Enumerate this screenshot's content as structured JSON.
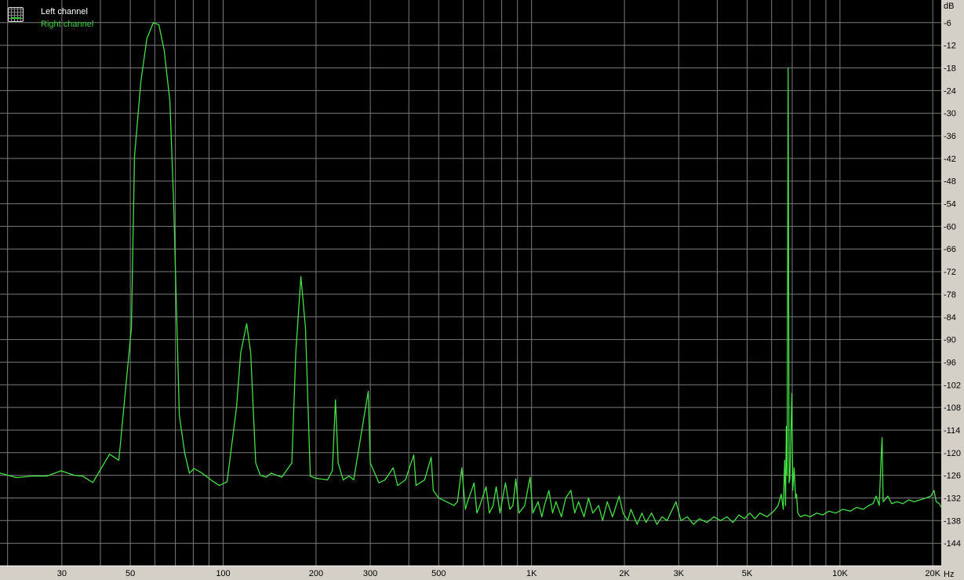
{
  "colors": {
    "background": "#000000",
    "grid": "#7a7a7a",
    "panel": "#d4d0c8",
    "right_channel": "#44e044",
    "left_channel": "#ffffff"
  },
  "legend": {
    "icon": "spectrum-graph-icon",
    "left_label": "Left channel",
    "right_label": "Right channel"
  },
  "chart_data": {
    "type": "line",
    "title": "",
    "xlabel": "Hz",
    "ylabel": "dB",
    "xscale": "log",
    "xlim": [
      18.9,
      21300
    ],
    "ylim": [
      -150,
      0
    ],
    "grid": true,
    "legend_position": "top-left",
    "x_ticks": [
      {
        "value": 30,
        "label": "30"
      },
      {
        "value": 50,
        "label": "50"
      },
      {
        "value": 100,
        "label": "100"
      },
      {
        "value": 200,
        "label": "200"
      },
      {
        "value": 300,
        "label": "300"
      },
      {
        "value": 500,
        "label": "500"
      },
      {
        "value": 1000,
        "label": "1K"
      },
      {
        "value": 2000,
        "label": "2K"
      },
      {
        "value": 3000,
        "label": "3K"
      },
      {
        "value": 5000,
        "label": "5K"
      },
      {
        "value": 10000,
        "label": "10K"
      },
      {
        "value": 20000,
        "label": "20K"
      }
    ],
    "x_grid": [
      20,
      30,
      40,
      50,
      60,
      70,
      80,
      90,
      100,
      200,
      300,
      400,
      500,
      600,
      700,
      800,
      900,
      1000,
      2000,
      3000,
      4000,
      5000,
      6000,
      7000,
      8000,
      9000,
      10000,
      20000
    ],
    "y_ticks": [
      "-6",
      "-12",
      "-18",
      "-24",
      "-30",
      "-36",
      "-42",
      "-48",
      "-54",
      "-60",
      "-66",
      "-72",
      "-78",
      "-84",
      "-90",
      "-96",
      "-102",
      "-108",
      "-114",
      "-120",
      "-126",
      "-132",
      "-138",
      "-144"
    ],
    "series": [
      {
        "name": "Right channel",
        "points": [
          [
            18.9,
            -125.4
          ],
          [
            21.4,
            -126.6
          ],
          [
            24,
            -126.2
          ],
          [
            26.8,
            -126.2
          ],
          [
            29.8,
            -124.8
          ],
          [
            32.9,
            -126
          ],
          [
            35,
            -126.2
          ],
          [
            37.8,
            -127.9
          ],
          [
            42.8,
            -120.4
          ],
          [
            45.9,
            -122
          ],
          [
            50.4,
            -87
          ],
          [
            51.6,
            -41.4
          ],
          [
            54.1,
            -21.6
          ],
          [
            56.6,
            -10.2
          ],
          [
            59.4,
            -6
          ],
          [
            61.9,
            -6.6
          ],
          [
            64.4,
            -13.3
          ],
          [
            67.2,
            -26.8
          ],
          [
            69.1,
            -53.9
          ],
          [
            72.1,
            -110
          ],
          [
            75,
            -120
          ],
          [
            77.7,
            -125.4
          ],
          [
            80.5,
            -124.2
          ],
          [
            85.4,
            -125.4
          ],
          [
            91.6,
            -127.3
          ],
          [
            97.1,
            -128.7
          ],
          [
            103,
            -127.7
          ],
          [
            110.5,
            -108
          ],
          [
            114,
            -93.5
          ],
          [
            119.2,
            -85.8
          ],
          [
            122.8,
            -93.5
          ],
          [
            127.5,
            -122.7
          ],
          [
            132,
            -126
          ],
          [
            138,
            -126.5
          ],
          [
            143,
            -125.4
          ],
          [
            155,
            -126.5
          ],
          [
            167,
            -122.7
          ],
          [
            172,
            -93.5
          ],
          [
            178.7,
            -73.3
          ],
          [
            185,
            -87
          ],
          [
            191.7,
            -126.2
          ],
          [
            200,
            -126.8
          ],
          [
            218,
            -127.2
          ],
          [
            226,
            -124.8
          ],
          [
            231.3,
            -106
          ],
          [
            236,
            -122.7
          ],
          [
            245,
            -127.2
          ],
          [
            256,
            -126.2
          ],
          [
            265,
            -127.2
          ],
          [
            295.5,
            -103.7
          ],
          [
            300,
            -122.7
          ],
          [
            320,
            -128
          ],
          [
            335,
            -127.2
          ],
          [
            356,
            -124
          ],
          [
            368,
            -128.7
          ],
          [
            390,
            -127.2
          ],
          [
            415,
            -120.6
          ],
          [
            422,
            -128.7
          ],
          [
            450,
            -127.2
          ],
          [
            472.5,
            -121.2
          ],
          [
            480,
            -130
          ],
          [
            500,
            -132
          ],
          [
            530,
            -133
          ],
          [
            560,
            -134
          ],
          [
            575,
            -133
          ],
          [
            594,
            -124
          ],
          [
            610,
            -135
          ],
          [
            620,
            -133
          ],
          [
            651,
            -128
          ],
          [
            665,
            -136
          ],
          [
            680,
            -134
          ],
          [
            712,
            -129
          ],
          [
            730,
            -136
          ],
          [
            750,
            -134
          ],
          [
            768,
            -129
          ],
          [
            790,
            -136
          ],
          [
            823,
            -128
          ],
          [
            850,
            -135
          ],
          [
            870,
            -134
          ],
          [
            889,
            -127
          ],
          [
            910,
            -136
          ],
          [
            950,
            -134
          ],
          [
            989,
            -126.5
          ],
          [
            1010,
            -136
          ],
          [
            1050,
            -133
          ],
          [
            1080,
            -137
          ],
          [
            1100,
            -134
          ],
          [
            1138,
            -130
          ],
          [
            1170,
            -136
          ],
          [
            1200,
            -133
          ],
          [
            1250,
            -137
          ],
          [
            1290,
            -132
          ],
          [
            1341,
            -130
          ],
          [
            1380,
            -136
          ],
          [
            1420,
            -133
          ],
          [
            1480,
            -137
          ],
          [
            1530,
            -132
          ],
          [
            1580,
            -136
          ],
          [
            1650,
            -134
          ],
          [
            1700,
            -138
          ],
          [
            1760,
            -133
          ],
          [
            1830,
            -137
          ],
          [
            1924,
            -131.5
          ],
          [
            1980,
            -136
          ],
          [
            2050,
            -138
          ],
          [
            2100,
            -135
          ],
          [
            2200,
            -139
          ],
          [
            2280,
            -136
          ],
          [
            2350,
            -138.5
          ],
          [
            2450,
            -136
          ],
          [
            2550,
            -139
          ],
          [
            2650,
            -137
          ],
          [
            2750,
            -138
          ],
          [
            2940,
            -133
          ],
          [
            3050,
            -138
          ],
          [
            3200,
            -137
          ],
          [
            3350,
            -139
          ],
          [
            3500,
            -137.5
          ],
          [
            3700,
            -138.5
          ],
          [
            3900,
            -137
          ],
          [
            4100,
            -138
          ],
          [
            4300,
            -137
          ],
          [
            4500,
            -138.5
          ],
          [
            4700,
            -136.5
          ],
          [
            4900,
            -137.5
          ],
          [
            5100,
            -136
          ],
          [
            5300,
            -137.5
          ],
          [
            5500,
            -136
          ],
          [
            5800,
            -137
          ],
          [
            6100,
            -135.5
          ],
          [
            6300,
            -134
          ],
          [
            6450,
            -131
          ],
          [
            6550,
            -135
          ],
          [
            6620,
            -122
          ],
          [
            6660,
            -134
          ],
          [
            6700,
            -113
          ],
          [
            6740,
            -126
          ],
          [
            6790,
            -18
          ],
          [
            6840,
            -128
          ],
          [
            6880,
            -127
          ],
          [
            6980,
            -104.3
          ],
          [
            7030,
            -130
          ],
          [
            7100,
            -124
          ],
          [
            7180,
            -132
          ],
          [
            7230,
            -131
          ],
          [
            7300,
            -136
          ],
          [
            7450,
            -137
          ],
          [
            7700,
            -136.5
          ],
          [
            8000,
            -137
          ],
          [
            8400,
            -136
          ],
          [
            8800,
            -136.5
          ],
          [
            9200,
            -135.5
          ],
          [
            9700,
            -136
          ],
          [
            10200,
            -135
          ],
          [
            10800,
            -135.5
          ],
          [
            11300,
            -134.5
          ],
          [
            11900,
            -135
          ],
          [
            12400,
            -134
          ],
          [
            12800,
            -133.5
          ],
          [
            13100,
            -131.5
          ],
          [
            13400,
            -134
          ],
          [
            13600,
            -121
          ],
          [
            13700,
            -116
          ],
          [
            13800,
            -133
          ],
          [
            14300,
            -131.5
          ],
          [
            14700,
            -133.5
          ],
          [
            15300,
            -133
          ],
          [
            16000,
            -133.5
          ],
          [
            16700,
            -132.5
          ],
          [
            17400,
            -133
          ],
          [
            18200,
            -132.5
          ],
          [
            19000,
            -132
          ],
          [
            19700,
            -131.5
          ],
          [
            20200,
            -130
          ],
          [
            20500,
            -133
          ],
          [
            21000,
            -133.5
          ],
          [
            21300,
            -134.5
          ]
        ]
      }
    ]
  }
}
